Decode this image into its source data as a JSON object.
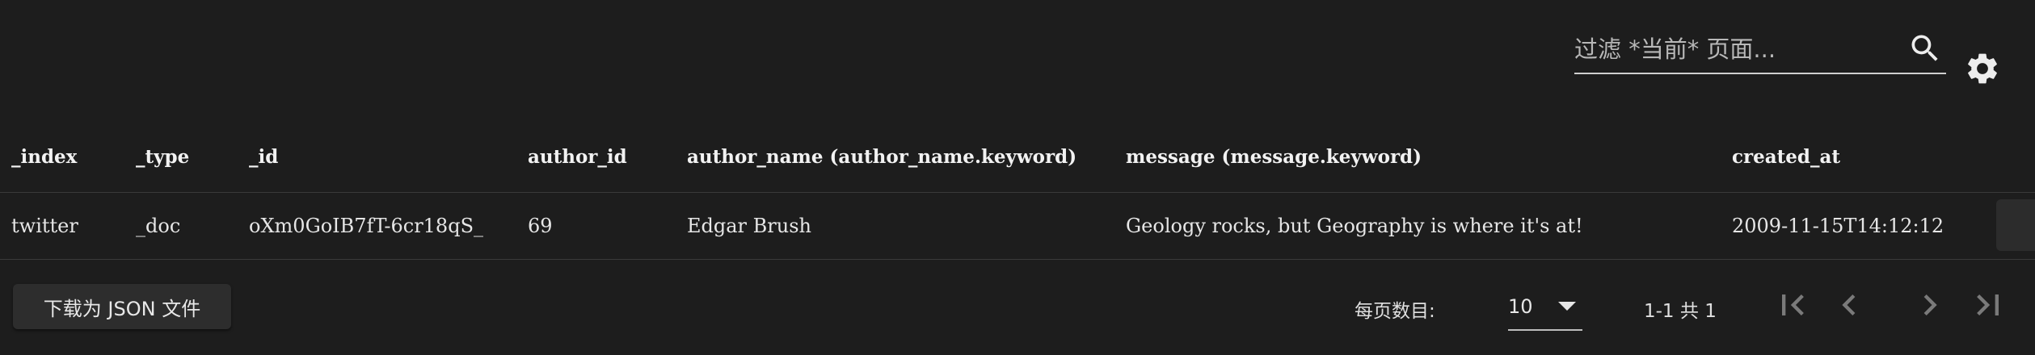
{
  "toolbar": {
    "search_placeholder": "过滤 *当前* 页面...",
    "search_value": ""
  },
  "table": {
    "columns": [
      {
        "label": "_index"
      },
      {
        "label": "_type"
      },
      {
        "label": "_id"
      },
      {
        "label": "author_id"
      },
      {
        "label": "author_name (author_name.keyword)"
      },
      {
        "label": "message (message.keyword)"
      },
      {
        "label": "created_at"
      }
    ],
    "rows": [
      {
        "cells": [
          "twitter",
          "_doc",
          "oXm0GoIB7fT-6cr18qS_",
          "69",
          "Edgar Brush",
          "Geology rocks, but Geography is where it's at!",
          "2009-11-15T14:12:12"
        ]
      }
    ]
  },
  "footer": {
    "download_label": "下载为 JSON 文件",
    "rows_per_page_label": "每页数目:",
    "rows_per_page_value": "10",
    "range_label": "1-1 共 1"
  },
  "colors": {
    "background": "#1d1d1d",
    "text": "#e6e6e6",
    "divider": "#3a3a3a",
    "button_bg": "#2d2d2d"
  },
  "icons": {
    "search": "search-icon",
    "settings": "gear-icon",
    "first_page": "first-page-icon",
    "prev_page": "chevron-left-icon",
    "next_page": "chevron-right-icon",
    "last_page": "last-page-icon",
    "dropdown": "caret-down-icon"
  }
}
